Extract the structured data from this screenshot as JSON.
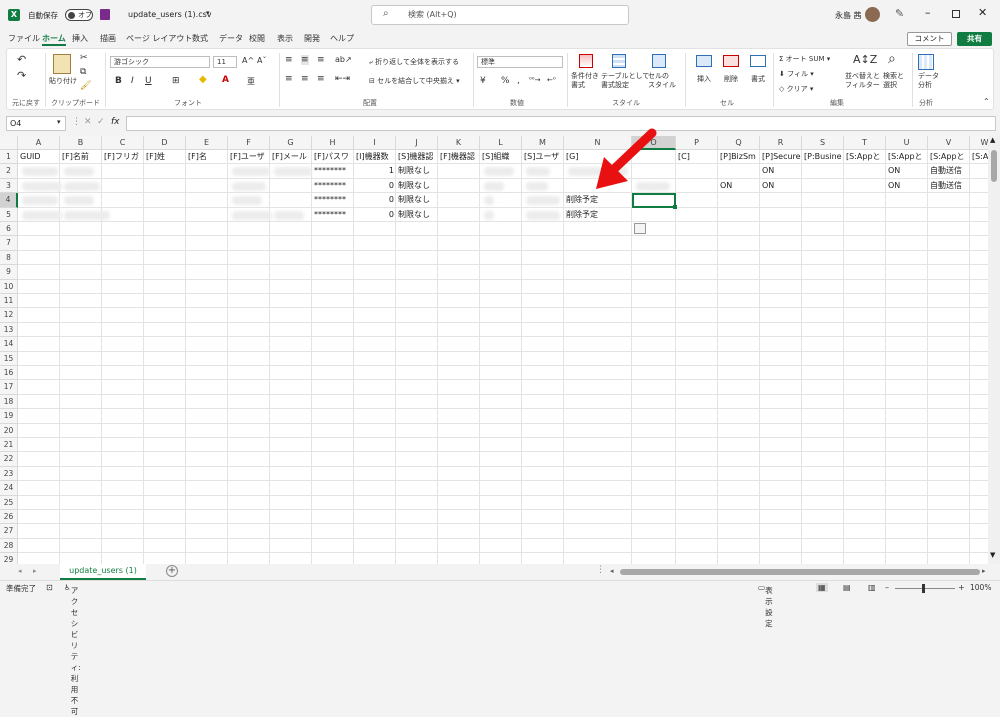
{
  "titlebar": {
    "autosave_label": "自動保存",
    "autosave_state": "オフ",
    "filename": "update_users (1).csv",
    "search_placeholder": "検索 (Alt+Q)",
    "user_name": "永島 茜"
  },
  "menu": {
    "items": [
      "ファイル",
      "ホーム",
      "挿入",
      "描画",
      "ページ レイアウト",
      "数式",
      "データ",
      "校閲",
      "表示",
      "開発",
      "ヘルプ"
    ],
    "active_index": 1,
    "comment_label": "コメント",
    "share_label": "共有"
  },
  "ribbon": {
    "undo_group": "元に戻す",
    "clipboard": {
      "paste": "貼り付け",
      "group": "クリップボード"
    },
    "font": {
      "name": "游ゴシック",
      "size": "11",
      "group": "フォント",
      "bold": "B",
      "italic": "I",
      "underline": "U",
      "grow": "A^",
      "shrink": "Aˇ",
      "color_a": "A",
      "phonetic": "亜"
    },
    "alignment": {
      "wrap": "折り返して全体を表示する",
      "merge": "セルを結合して中央揃え",
      "group": "配置"
    },
    "number": {
      "format": "標準",
      "group": "数値",
      "currency": "¥",
      "percent": "%",
      "comma": ","
    },
    "styles": {
      "conditional": "条件付き\n書式",
      "table": "テーブルとして\n書式設定",
      "cell": "セルの\nスタイル",
      "group": "スタイル"
    },
    "cells": {
      "insert": "挿入",
      "delete": "削除",
      "format": "書式",
      "group": "セル"
    },
    "editing": {
      "autosum": "オート SUM",
      "fill": "フィル",
      "clear": "クリア",
      "sort": "並べ替えと\nフィルター",
      "find": "検索と\n選択",
      "group": "編集"
    },
    "analysis": {
      "data": "データ\n分析",
      "group": "分析"
    }
  },
  "formula": {
    "name_box": "O4",
    "fx_label": "fx",
    "value": ""
  },
  "grid": {
    "columns": [
      "A",
      "B",
      "C",
      "D",
      "E",
      "F",
      "G",
      "H",
      "I",
      "J",
      "K",
      "L",
      "M",
      "N",
      "O",
      "P",
      "Q",
      "R",
      "S",
      "T",
      "U",
      "V",
      "W"
    ],
    "rows": [
      "1",
      "2",
      "3",
      "4",
      "5",
      "6",
      "7",
      "8",
      "9",
      "10",
      "11",
      "12",
      "13",
      "14",
      "15",
      "16",
      "17",
      "18",
      "19",
      "20",
      "21",
      "22",
      "23",
      "24",
      "25",
      "26",
      "27",
      "28",
      "29"
    ],
    "cells": {
      "A1": "GUID",
      "B1": "[F]名前",
      "C1": "[F]フリガ",
      "D1": "[F]姓",
      "E1": "[F]名",
      "F1": "[F]ユーザ",
      "G1": "[F]メール",
      "H1": "[F]パスワ",
      "I1": "[I]機器数",
      "J1": "[S]機器認",
      "K1": "[F]機器認",
      "L1": "[S]組織",
      "M1": "[S]ユーザ",
      "N1": "[G]",
      "O1": "",
      "P1": "[C]",
      "Q1": "[P]BizSm",
      "R1": "[P]Secure",
      "S1": "[P:Busine",
      "T1": "[S:Appと",
      "U1": "[S:Appと",
      "V1": "[S:Appと",
      "W1": "[S:A",
      "H2": "********",
      "I2": "1",
      "J2": "制限なし",
      "R2": "ON",
      "U2": "ON",
      "V2": "自動送信",
      "H3": "********",
      "I3": "0",
      "J3": "制限なし",
      "Q3": "ON",
      "R3": "ON",
      "U3": "ON",
      "V3": "自動送信",
      "H4": "********",
      "I4": "0",
      "J4": "制限なし",
      "N4": "削除予定",
      "H5": "********",
      "I5": "0",
      "J5": "制限なし",
      "N5": "削除予定"
    }
  },
  "sheets": {
    "tabs": [
      "update_users (1)"
    ],
    "add_label": "+"
  },
  "status": {
    "ready": "準備完了",
    "accessibility": "アクセシビリティ: 利用不可",
    "display_settings": "表示設定",
    "zoom": "100%"
  },
  "colors": {
    "accent": "#107c41",
    "arrow": "#e81010",
    "selection": "#107c41"
  }
}
